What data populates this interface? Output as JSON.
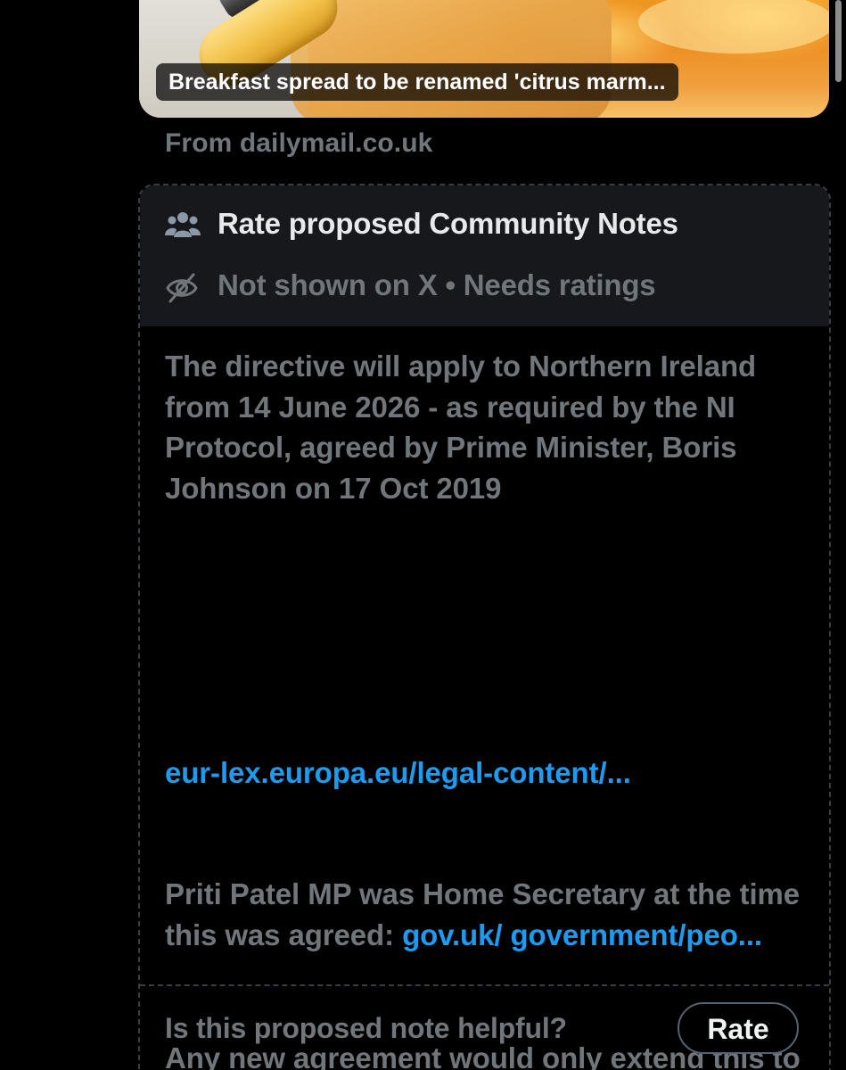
{
  "card": {
    "headline": "Breakfast spread to be renamed 'citrus marm...",
    "source": "From dailymail.co.uk"
  },
  "notes": {
    "header_title": "Rate proposed Community Notes",
    "header_icon": "people-group-icon",
    "status": "Not shown on X • Needs ratings",
    "status_icon": "eye-slash-icon",
    "body": {
      "para1": "The directive will apply to Northern Ireland from 14 June 2026 - as required by the NI Protocol, agreed by Prime Minister, Boris Johnson on 17 Oct 2019",
      "link1": "eur-lex.europa.eu/legal-content/...",
      "para2_text": "Priti Patel MP was Home Secretary at the time this was agreed: ",
      "link2": "gov.uk/ government/peo...",
      "para3": "Any new agreement would only extend this to GB, if agreed"
    },
    "footer_question": "Is this proposed note helpful?",
    "rate_label": "Rate"
  },
  "colors": {
    "background": "#000000",
    "header_bg": "#16181c",
    "primary_text": "#e7e9ea",
    "secondary_text": "#71767b",
    "link": "#1d9bf0",
    "border": "#3a3d42"
  }
}
